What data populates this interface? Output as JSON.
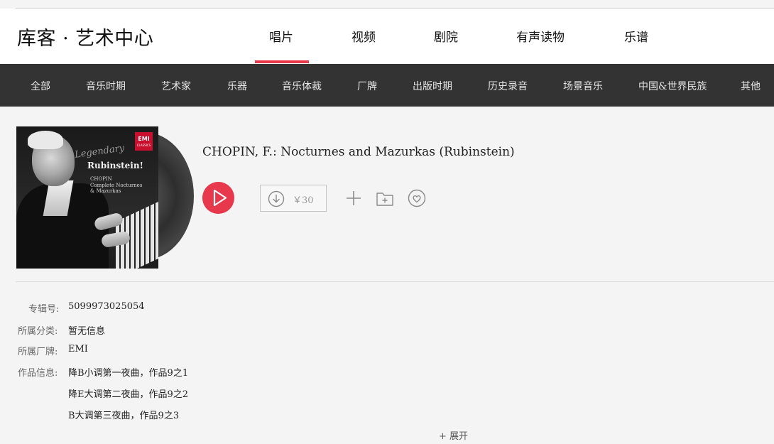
{
  "header": {
    "logo": "库客 · 艺术中心",
    "nav": [
      {
        "label": "唱片",
        "active": true
      },
      {
        "label": "视频",
        "active": false
      },
      {
        "label": "剧院",
        "active": false
      },
      {
        "label": "有声读物",
        "active": false
      },
      {
        "label": "乐谱",
        "active": false
      }
    ]
  },
  "categories": [
    "全部",
    "音乐时期",
    "艺术家",
    "乐器",
    "音乐体裁",
    "厂牌",
    "出版时期",
    "历史录音",
    "场景音乐",
    "中国&世界民族",
    "其他"
  ],
  "album": {
    "title": "CHOPIN, F.: Nocturnes and Mazurkas (Rubinstein)",
    "cover": {
      "legendary": "Legendary",
      "name": "Rubinstein!",
      "line1": "CHOPIN",
      "line2": "Complete Nocturnes",
      "line3": "& Mazurkas",
      "badge": "EMI",
      "badge_sub": "CLASSICS"
    },
    "price": "￥30"
  },
  "info": {
    "album_no_label": "专辑号:",
    "album_no": "5099973025054",
    "category_label": "所属分类:",
    "category": "暂无信息",
    "label_label": "所属厂牌:",
    "label": "EMI",
    "works_label": "作品信息:",
    "works": [
      "降B小调第一夜曲，作品9之1",
      "降E大调第二夜曲，作品9之2",
      "B大调第三夜曲，作品9之3"
    ],
    "expand": "+ 展开"
  },
  "colors": {
    "accent": "#e8384b",
    "category_bar": "#333333"
  },
  "icons": {
    "play": "play-icon",
    "download": "download-icon",
    "add": "plus-icon",
    "folder": "add-to-folder-icon",
    "favorite": "heart-icon"
  }
}
